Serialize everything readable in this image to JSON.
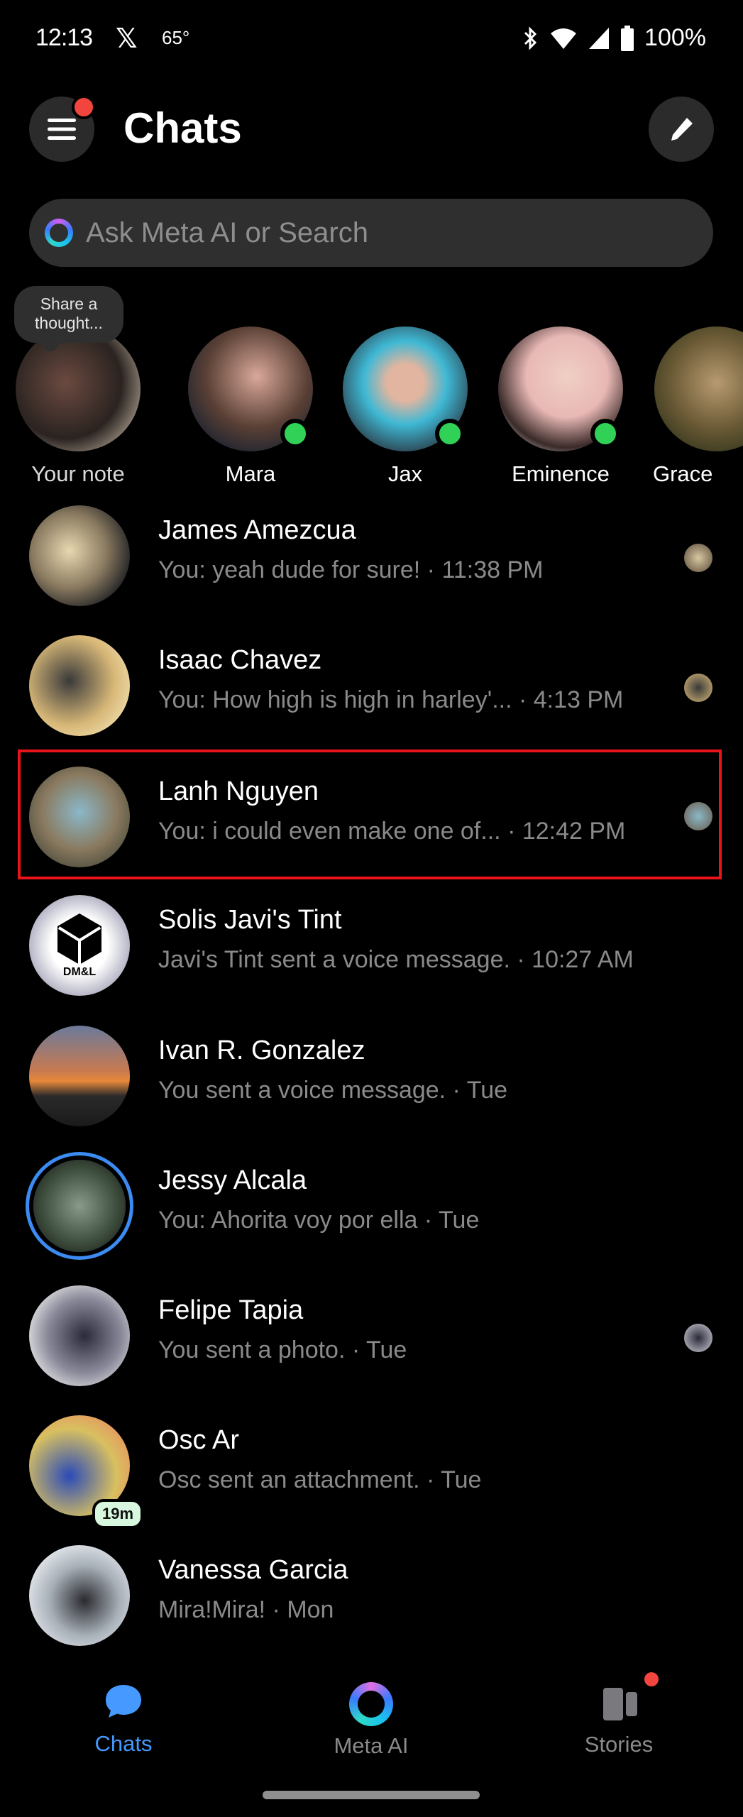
{
  "status_bar": {
    "time": "12:13",
    "notification_icon": "x-logo-icon",
    "temperature": "65°",
    "battery": "100%",
    "icons": [
      "bluetooth-icon",
      "wifi-icon",
      "signal-icon",
      "battery-icon"
    ]
  },
  "header": {
    "title": "Chats",
    "menu_icon": "hamburger-menu-icon",
    "compose_icon": "pencil-icon"
  },
  "search": {
    "placeholder": "Ask Meta AI or Search",
    "value": ""
  },
  "stories": {
    "note_bubble": "Share a thought...",
    "items": [
      {
        "name": "Your note",
        "online": false
      },
      {
        "name": "Mara",
        "online": true
      },
      {
        "name": "Jax",
        "online": true
      },
      {
        "name": "Eminence",
        "online": true
      },
      {
        "name": "Grace",
        "online": false
      }
    ]
  },
  "chats": [
    {
      "name": "James Amezcua",
      "preview": "You: yeah dude for sure! · 11:38 PM",
      "seen": true
    },
    {
      "name": "Isaac Chavez",
      "preview": "You: How high is high in harley'...  · 4:13 PM",
      "seen": true
    },
    {
      "name": "Lanh Nguyen",
      "preview": "You: i could even make one of... · 12:42 PM",
      "seen": true,
      "highlighted": true
    },
    {
      "name": "Solis Javi's Tint",
      "preview": "Javi's Tint sent a voice message. · 10:27 AM",
      "seen": false
    },
    {
      "name": "Ivan R. Gonzalez",
      "preview": "You sent a voice message. · Tue",
      "seen": false
    },
    {
      "name": "Jessy Alcala",
      "preview": "You: Ahorita voy por ella · Tue",
      "seen": false,
      "story_ring": true
    },
    {
      "name": "Felipe Tapia",
      "preview": "You sent a photo. · Tue",
      "seen": true
    },
    {
      "name": "Osc Ar",
      "preview": "Osc sent an attachment. · Tue",
      "seen": false,
      "active_badge": "19m"
    },
    {
      "name": "Vanessa Garcia",
      "preview": "Mira!Mira! · Mon",
      "seen": false
    }
  ],
  "avatar_logo_text": "DM&L",
  "bottom_nav": {
    "tabs": [
      {
        "label": "Chats",
        "icon": "chat-bubble-icon",
        "active": true
      },
      {
        "label": "Meta AI",
        "icon": "meta-ai-ring-icon",
        "active": false
      },
      {
        "label": "Stories",
        "icon": "stories-icon",
        "active": false,
        "notification_dot": true
      }
    ]
  },
  "colors": {
    "accent": "#4599ff",
    "online": "#31d158",
    "notification": "#f2453d",
    "highlight_box": "#e8141a",
    "background": "#000000",
    "muted_text": "#8a8a8a"
  }
}
